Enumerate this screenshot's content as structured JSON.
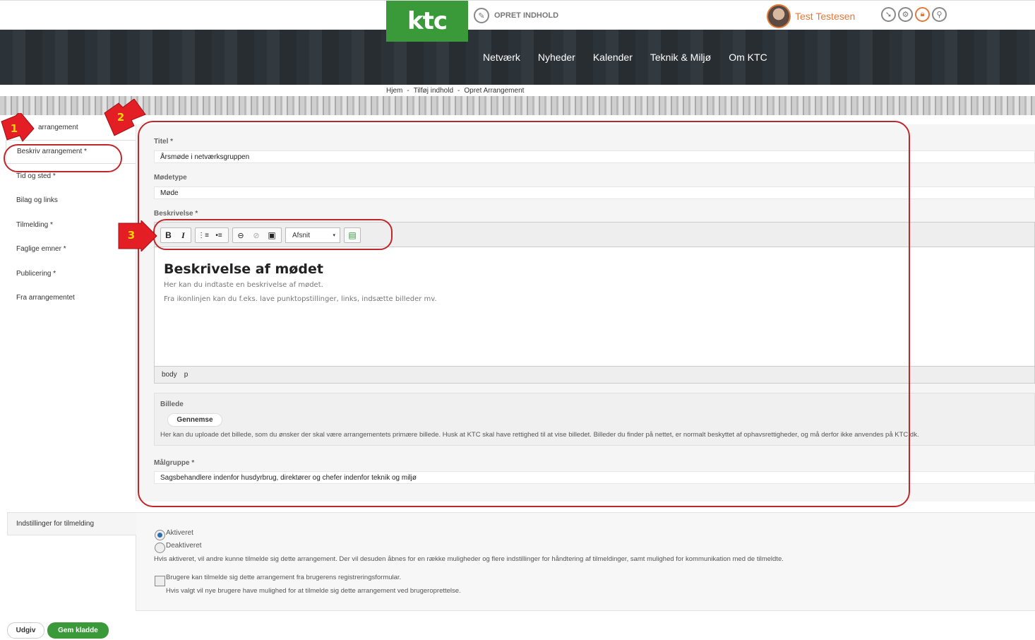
{
  "header": {
    "logo_text": "ktc",
    "create_label": "OPRET INDHOLD",
    "user_name": "Test Testesen",
    "tool_icons": [
      "download-icon",
      "gear-icon",
      "lock-icon",
      "search-icon"
    ]
  },
  "nav": [
    "Netværk",
    "Nyheder",
    "Kalender",
    "Teknik & Miljø",
    "Om KTC"
  ],
  "breadcrumb": [
    "Hjem",
    "Tilføj indhold",
    "Opret Arrangement"
  ],
  "breadcrumb_sep": "-",
  "sidebar": [
    "arrangement",
    "Beskriv arrangement *",
    "Tid og sted *",
    "Bilag og links",
    "Tilmelding *",
    "Faglige emner *",
    "Publicering *",
    "Fra arrangementet"
  ],
  "form": {
    "title_label": "Titel *",
    "title_value": "Årsmøde i netværksgruppen",
    "type_label": "Mødetype",
    "type_value": "Møde",
    "desc_label": "Beskrivelse *",
    "editor": {
      "format_select": "Afsnit",
      "heading": "Beskrivelse af mødet",
      "para1": "Her kan du indtaste en beskrivelse af mødet.",
      "para2": "Fra ikonlinjen kan du f.eks. lave punktopstillinger, links, indsætte billeder mv.",
      "status": [
        "body",
        "p"
      ]
    },
    "image_label": "Billede",
    "image_button": "Gennemse",
    "image_help": "Her kan du uploade det billede, som du ønsker der skal være arrangementets primære billede. Husk at KTC skal have rettighed til at vise billedet. Billeder du finder på nettet, er normalt beskyttet af ophavsrettigheder, og må derfor ikke anvendes på KTC.dk.",
    "audience_label": "Målgruppe *",
    "audience_value": "Sagsbehandlere indenfor husdyrbrug, direktører og chefer indenfor teknik og miljø"
  },
  "settings": {
    "tab": "Indstillinger for tilmelding",
    "opt_on": "Aktiveret",
    "opt_off": "Deaktiveret",
    "help": "Hvis aktiveret, vil andre kunne tilmelde sig dette arrangement. Der vil desuden åbnes for en række muligheder og flere indstillinger for håndtering af tilmeldinger, samt mulighed for kommunikation med de tilmeldte.",
    "checkbox_label": "Brugere kan tilmelde sig dette arrangement fra brugerens registreringsformular.",
    "checkbox_help": "Hvis valgt vil nye brugere have mulighed for at tilmelde sig dette arrangement ved brugeroprettelse."
  },
  "actions": {
    "publish": "Udgiv",
    "save_draft": "Gem kladde"
  },
  "annotations": [
    "1",
    "2",
    "3"
  ],
  "colors": {
    "brand_green": "#3a9a3a",
    "user_orange": "#e07a3b",
    "annotation_red": "#c0272d",
    "annotation_yellow": "#ffd700"
  }
}
